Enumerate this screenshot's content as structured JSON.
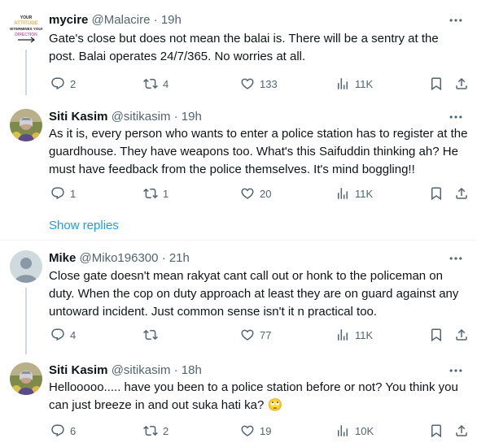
{
  "tweets": [
    {
      "name": "mycire",
      "handle": "@Malacire",
      "time": "19h",
      "text": "Gate's close but does not mean the balai is. There will be a sentry at the post. Balai operates 24/7/365. No worries at all.",
      "replies": "2",
      "retweets": "4",
      "likes": "133",
      "views": "11K"
    },
    {
      "name": "Siti Kasim",
      "handle": "@sitikasim",
      "time": "19h",
      "text": "As it is, every person who wants to enter a police station has to register at the guardhouse. They have weapons too. What's this Saifuddin thinking ah? He must have feedback from the police themselves.  It's mind boggling!!",
      "replies": "1",
      "retweets": "1",
      "likes": "20",
      "views": "11K"
    },
    {
      "name": "Mike",
      "handle": "@Miko196300",
      "time": "21h",
      "text": "Close gate doesn't mean rakyat cant call out or honk to the policeman on duty. When the cop on duty approach at least they are on guard against any untoward incident. Just common sense isn't it n practical too.",
      "replies": "4",
      "retweets": "",
      "likes": "77",
      "views": "11K"
    },
    {
      "name": "Siti Kasim",
      "handle": "@sitikasim",
      "time": "18h",
      "text": "Hellooooo..... have you been to a police station before or not? You think you can just breeze in and out suka hati ka? 🙄",
      "replies": "6",
      "retweets": "2",
      "likes": "19",
      "views": "10K"
    }
  ],
  "show_replies": "Show replies",
  "avatar_texts": {
    "mycire": [
      "YOUR",
      "ATTITUDE",
      "DETERMINES YOUR",
      "DIRECTION"
    ]
  },
  "icons": {
    "reply": "reply-icon",
    "retweet": "retweet-icon",
    "like": "like-icon",
    "views": "views-icon",
    "bookmark": "bookmark-icon",
    "share": "share-icon",
    "more": "more-icon"
  },
  "colors": {
    "link": "#1d9bf0",
    "muted": "#536471",
    "text": "#0f1419",
    "divider": "#eff3f4"
  }
}
